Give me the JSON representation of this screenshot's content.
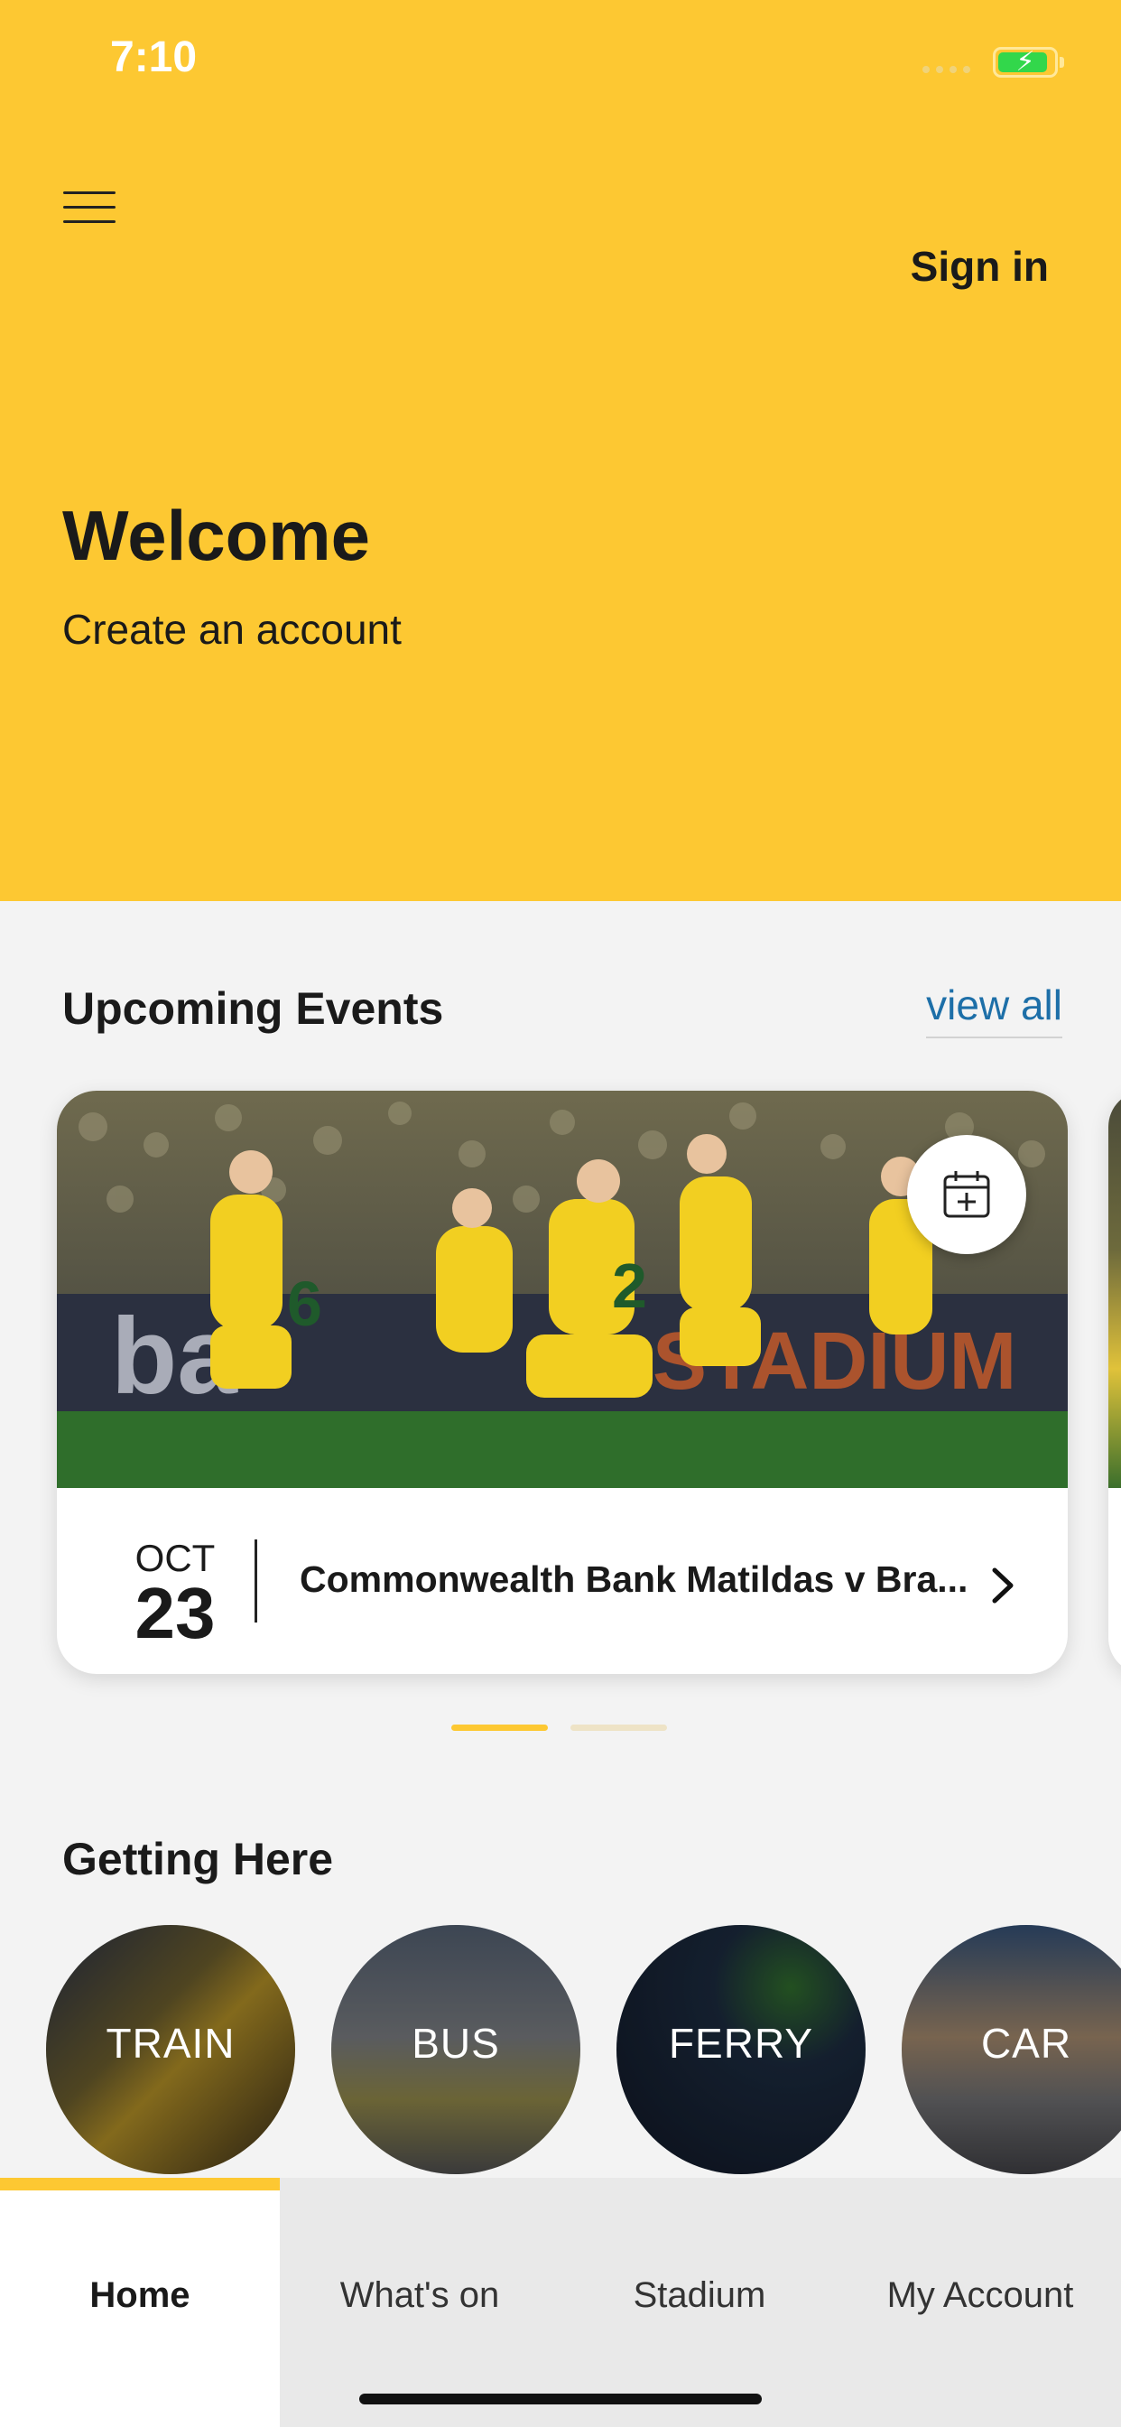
{
  "status_bar": {
    "time": "7:10",
    "battery_icon": "battery-charging-icon"
  },
  "header": {
    "menu_icon": "hamburger-menu-icon",
    "sign_in_label": "Sign in"
  },
  "hero": {
    "title": "Welcome",
    "create_account_label": "Create an account",
    "background_color": "#fdc832"
  },
  "events": {
    "section_title": "Upcoming Events",
    "view_all_label": "view all",
    "cards": [
      {
        "month": "OCT",
        "day": "23",
        "title": "Commonwealth Bank Matildas v Bra...",
        "calendar_icon": "calendar-add-icon",
        "chevron_icon": "chevron-right-icon"
      }
    ],
    "pager": {
      "page_count": 2,
      "active_index": 0,
      "active_color": "#fdc832",
      "inactive_color": "#eee3c6"
    }
  },
  "getting_here": {
    "section_title": "Getting Here",
    "options": [
      {
        "label": "TRAIN"
      },
      {
        "label": "BUS"
      },
      {
        "label": "FERRY"
      },
      {
        "label": "CAR"
      }
    ]
  },
  "tabbar": {
    "tabs": [
      {
        "label": "Home",
        "active": true
      },
      {
        "label": "What's on",
        "active": false
      },
      {
        "label": "Stadium",
        "active": false
      },
      {
        "label": "My Account",
        "active": false
      }
    ],
    "accent_color": "#fdc832"
  }
}
